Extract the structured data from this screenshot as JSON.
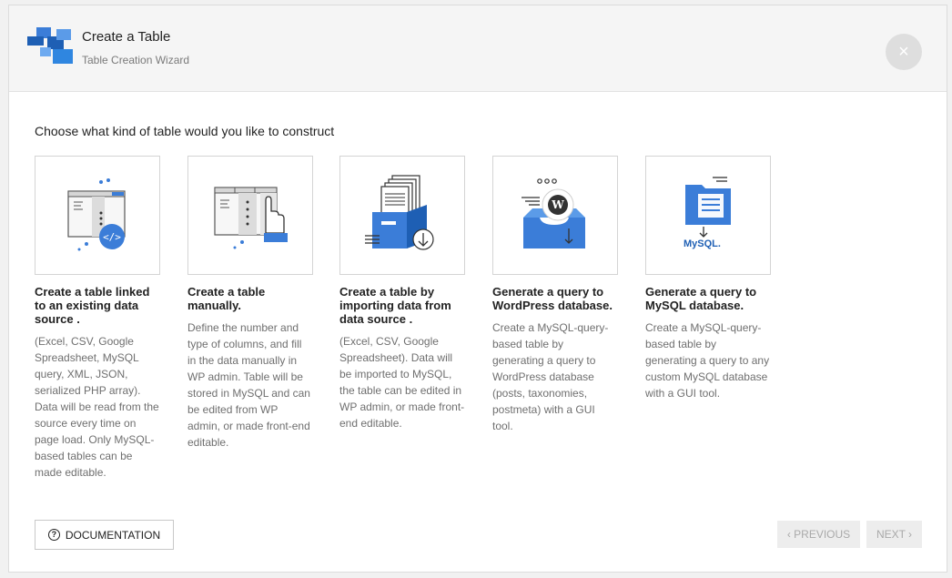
{
  "header": {
    "title": "Create a Table",
    "subtitle": "Table Creation Wizard",
    "close_label": "×"
  },
  "main": {
    "question": "Choose what kind of table would you like to construct",
    "cards": [
      {
        "title": "Create a table linked to an existing data source .",
        "description": "(Excel, CSV, Google Spreadsheet, MySQL query, XML, JSON, serialized PHP array). Data will be read from the source every time on page load. Only MySQL-based tables can be made editable.",
        "icon": "linked-table-icon"
      },
      {
        "title": "Create a table manually.",
        "description": "Define the number and type of columns, and fill in the data manually in WP admin. Table will be stored in MySQL and can be edited from WP admin, or made front-end editable.",
        "icon": "manual-table-icon"
      },
      {
        "title": "Create a table by importing data from data source .",
        "description": "(Excel, CSV, Google Spreadsheet). Data will be imported to MySQL, the table can be edited in WP admin, or made front-end editable.",
        "icon": "import-data-icon"
      },
      {
        "title": "Generate a query to WordPress database.",
        "description": "Create a MySQL-query-based table by generating a query to WordPress database (posts, taxonomies, postmeta) with a GUI tool.",
        "icon": "wordpress-query-icon"
      },
      {
        "title": "Generate a query to MySQL database.",
        "description": "Create a MySQL-query-based table by generating a query to any custom MySQL database with a GUI tool.",
        "icon": "mysql-query-icon",
        "icon_text": "MySQL."
      }
    ]
  },
  "footer": {
    "documentation_label": "DOCUMENTATION",
    "previous_label": "‹ PREVIOUS",
    "next_label": "NEXT ›"
  },
  "colors": {
    "blue": "#3b7dd8",
    "dark_blue": "#1e5fb4",
    "orange": "#e8a32c"
  }
}
